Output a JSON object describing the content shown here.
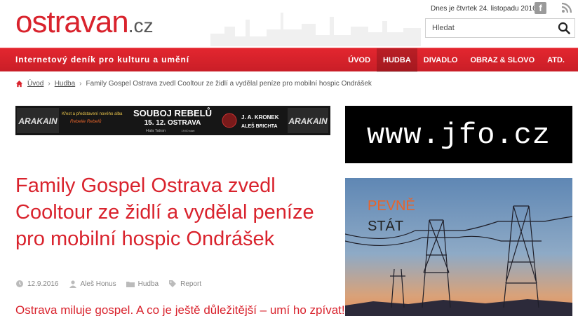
{
  "site": {
    "logo_main": "ostravan",
    "logo_tld": ".cz",
    "date_text": "Dnes je čtvrtek 24. listopadu 2016",
    "search_placeholder": "Hledat",
    "tagline": "Internetový deník pro kulturu a umění"
  },
  "nav": {
    "items": [
      {
        "label": "ÚVOD"
      },
      {
        "label": "HUDBA",
        "active": true
      },
      {
        "label": "DIVADLO"
      },
      {
        "label": "OBRAZ & SLOVO"
      },
      {
        "label": "ATD."
      }
    ]
  },
  "breadcrumb": {
    "home": "Úvod",
    "section": "Hudba",
    "current": "Family Gospel Ostrava zvedl Cooltour ze židlí a vydělal peníze pro mobilní hospic Ondrášek"
  },
  "banners": {
    "left": {
      "logo": "ARAKAIN",
      "line1": "Křest a představení nového alba",
      "line2": "Rebelie Rebelů",
      "headline": "SOUBOJ REBELŮ",
      "date": "15. 12. OSTRAVA",
      "venue": "Hala Tatran",
      "start": "19:00 start",
      "guest1": "J. A. KRONEK",
      "guest2": "ALEŠ BRICHTA"
    },
    "right_text": "www.jfo.cz",
    "ad_headline_1": "PEVNĚ",
    "ad_headline_2": "STÁT"
  },
  "article": {
    "title": "Family Gospel Ostrava zvedl Cooltour ze židlí a vydělal peníze pro mobilní hospic Ondrášek",
    "date": "12.9.2016",
    "author": "Aleš Honus",
    "category": "Hudba",
    "type": "Report",
    "lead": "Ostrava miluje gospel. A co je ještě důležitější – umí ho zpívat!"
  },
  "colors": {
    "brand_red": "#d9232d",
    "ad_orange": "#e8642a"
  }
}
